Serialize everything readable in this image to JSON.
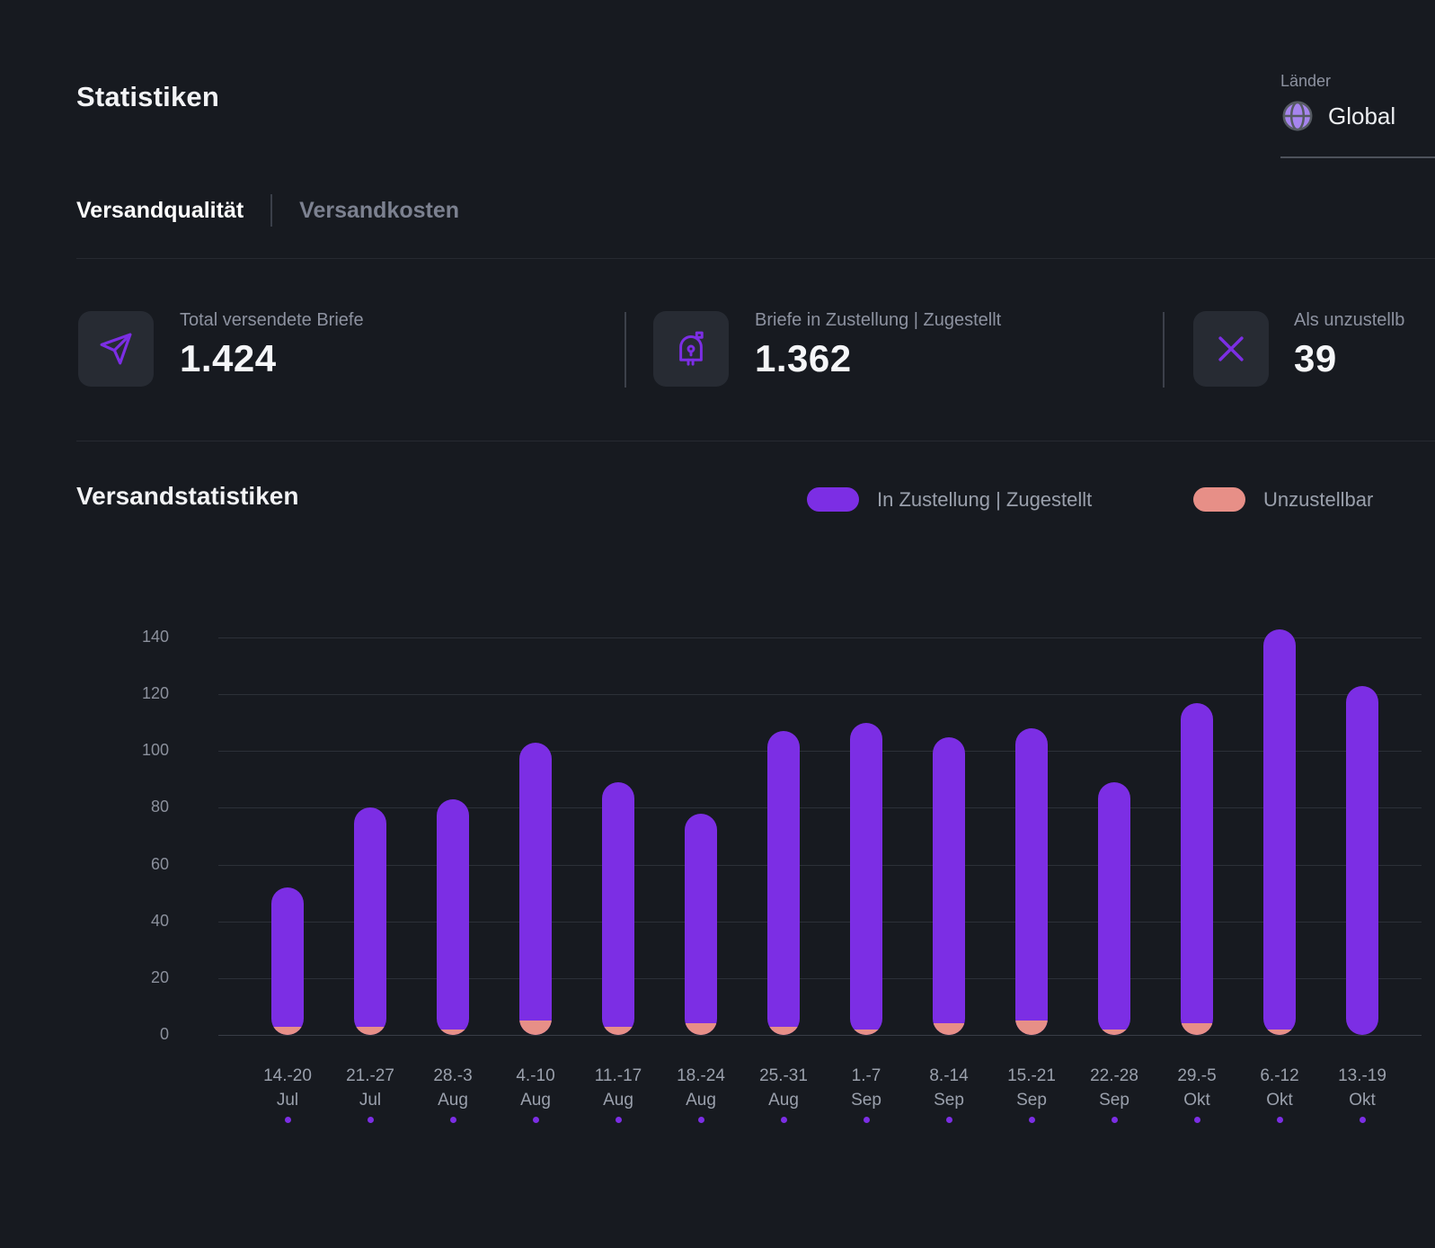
{
  "page": {
    "title": "Statistiken"
  },
  "country_selector": {
    "label": "Länder",
    "value": "Global"
  },
  "tabs": {
    "quality": "Versandqualität",
    "costs": "Versandkosten"
  },
  "stats": [
    {
      "icon": "send-icon",
      "label": "Total versendete Briefe",
      "value": "1.424"
    },
    {
      "icon": "mailbox-icon",
      "label": "Briefe in Zustellung | Zugestellt",
      "value": "1.362"
    },
    {
      "icon": "x-icon",
      "label": "Als unzustellb",
      "value": "39"
    }
  ],
  "section": {
    "title": "Versandstatistiken"
  },
  "legend": [
    {
      "label": "In Zustellung | Zugestellt",
      "color": "#7c2ee4"
    },
    {
      "label": "Unzustellbar",
      "color": "#e78f87"
    }
  ],
  "colors": {
    "accent_purple": "#7c2ee4",
    "salmon": "#e78f87",
    "globe_fill": "#a685ee",
    "globe_lines": "#565b63",
    "background": "#171a20"
  },
  "chart_data": {
    "type": "bar",
    "stacked": true,
    "title": "Versandstatistiken",
    "categories": [
      "14.-20 Jul",
      "21.-27 Jul",
      "28.-3 Aug",
      "4.-10 Aug",
      "11.-17 Aug",
      "18.-24 Aug",
      "25.-31 Aug",
      "1.-7 Sep",
      "8.-14 Sep",
      "15.-21 Sep",
      "22.-28 Sep",
      "29.-5 Okt",
      "6.-12 Okt",
      "13.-19 Okt"
    ],
    "series": [
      {
        "name": "In Zustellung | Zugestellt",
        "color": "#7c2ee4",
        "values": [
          49,
          77,
          81,
          98,
          86,
          74,
          104,
          108,
          101,
          103,
          87,
          113,
          141,
          123
        ]
      },
      {
        "name": "Unzustellbar",
        "color": "#e78f87",
        "values": [
          3,
          3,
          2,
          5,
          3,
          4,
          3,
          2,
          4,
          5,
          2,
          4,
          2,
          0
        ]
      }
    ],
    "totals": [
      52,
      80,
      83,
      103,
      89,
      78,
      107,
      110,
      105,
      108,
      89,
      117,
      143,
      123
    ],
    "ylim": [
      0,
      140
    ],
    "yticks": [
      0,
      20,
      40,
      60,
      80,
      100,
      120,
      140
    ],
    "grid": true,
    "legend_position": "top-right"
  }
}
